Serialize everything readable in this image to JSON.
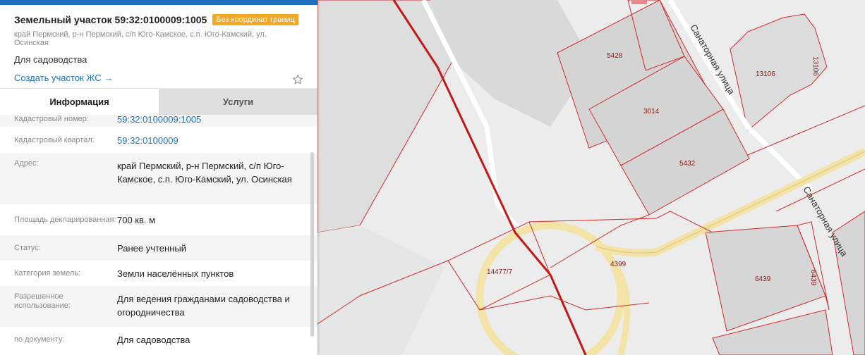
{
  "header": {
    "title": "Земельный участок 59:32:0100009:1005",
    "badge": "Без координат границ",
    "address": "край Пермский, р-н Пермский, с/п Юго-Камское, с.п. Юго-Камский, ул. Осинская",
    "purpose": "Для садоводства",
    "create_link": "Создать участок ЖС →"
  },
  "tabs": [
    {
      "label": "Информация"
    },
    {
      "label": "Услуги"
    }
  ],
  "info": {
    "cadastral_number": {
      "label": "Кадастровый номер:",
      "value": "59:32:0100009:1005"
    },
    "cadastral_quarter": {
      "label": "Кадастровый квартал:",
      "value": "59:32:0100009"
    },
    "address": {
      "label": "Адрес:",
      "value": "край Пермский, р-н Пермский, с/п Юго-Камское, с.п. Юго-Камский, ул. Осинская"
    },
    "area": {
      "label": "Площадь декларированная:",
      "value": "700 кв. м"
    },
    "status": {
      "label": "Статус:",
      "value": "Ранее учтенный"
    },
    "land_category": {
      "label": "Категория земель:",
      "value": "Земли населённых пунктов"
    },
    "permitted_use": {
      "label": "Разрешенное использование:",
      "value": "Для ведения гражданами садоводства и огородничества"
    },
    "by_document": {
      "label": "по документу:",
      "value": "Для садоводства"
    }
  },
  "map": {
    "street_labels": [
      "Санаторная улица",
      "Санаторная улица"
    ],
    "parcel_labels": [
      "5428",
      "3014",
      "5432",
      "13106",
      "13106",
      "14477/7",
      "4399",
      "6439",
      "6439"
    ]
  },
  "colors": {
    "accent": "#1f6fbf",
    "badge": "#f5a623",
    "link": "#1a73c8",
    "parcel_border": "#d42a2a",
    "parcel_fill": "#dcdcdc",
    "road": "#f4e3a6"
  }
}
